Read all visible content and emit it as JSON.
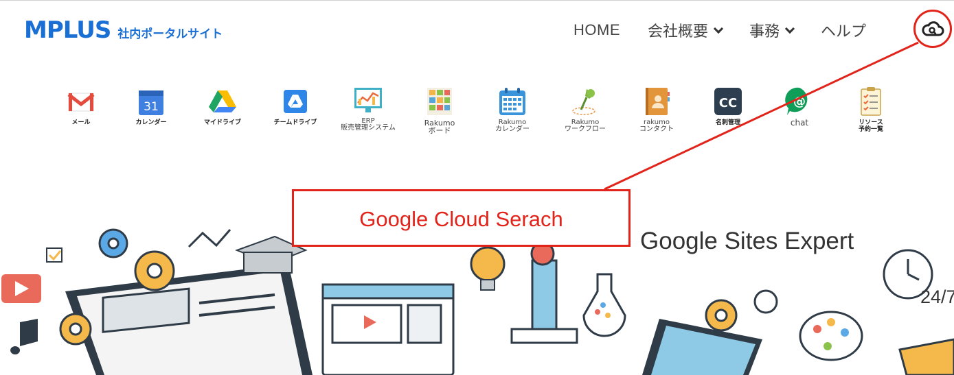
{
  "header": {
    "logo_main": "MPLUS",
    "logo_sub": "社内ポータルサイト"
  },
  "nav": {
    "home": "HOME",
    "company": "会社概要",
    "jimu": "事務",
    "help": "ヘルプ"
  },
  "apps": [
    {
      "label": "メール",
      "icon": "gmail-icon"
    },
    {
      "label": "カレンダー",
      "icon": "calendar-icon",
      "badge": "31"
    },
    {
      "label": "マイドライブ",
      "icon": "drive-icon"
    },
    {
      "label": "チームドライブ",
      "icon": "team-drive-icon"
    },
    {
      "label": "ERP\n販売管理システム",
      "icon": "erp-icon"
    },
    {
      "label": "Rakumo\nボード",
      "icon": "rakumo-board-icon"
    },
    {
      "label": "Rakumo\nカレンダー",
      "icon": "rakumo-calendar-icon"
    },
    {
      "label": "Rakumo\nワークフロー",
      "icon": "rakumo-workflow-icon"
    },
    {
      "label": "rakumo\nコンタクト",
      "icon": "rakumo-contact-icon"
    },
    {
      "label": "名刺管理",
      "icon": "card-management-icon",
      "badge": "CC"
    },
    {
      "label": "chat",
      "icon": "chat-icon",
      "badge": "@"
    },
    {
      "label": "リソース\n予約一覧",
      "icon": "resource-icon"
    }
  ],
  "callout": {
    "text": "Google Cloud Serach"
  },
  "hero": {
    "title": "Google Sites Expert",
    "side_text": "24/7"
  },
  "colors": {
    "brand": "#1a6fd4",
    "callout": "#e2231a"
  }
}
